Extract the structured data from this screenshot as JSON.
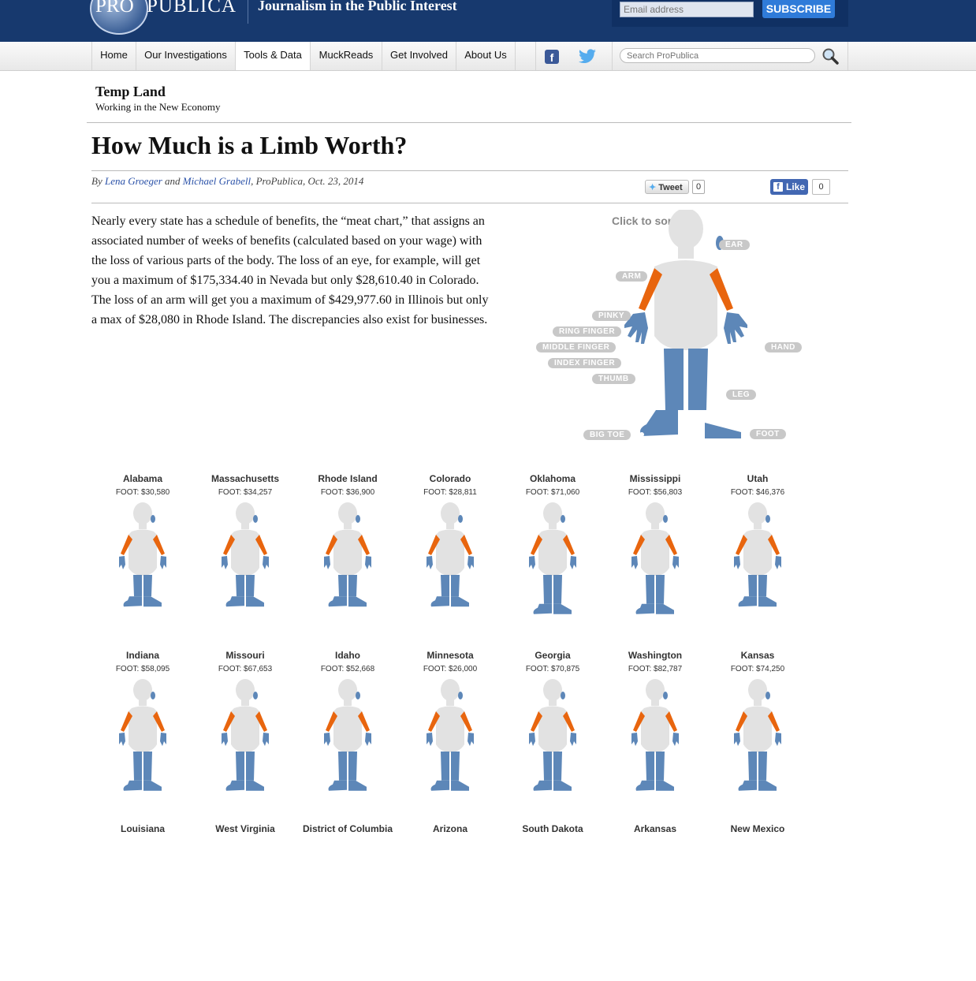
{
  "header": {
    "logo_pro": "PRO",
    "logo_publica": "PUBLICA",
    "tagline": "Journalism in the Public Interest",
    "email_placeholder": "Email address",
    "subscribe_label": "SUBSCRIBE"
  },
  "nav": {
    "items": [
      {
        "label": "Home"
      },
      {
        "label": "Our Investigations"
      },
      {
        "label": "Tools & Data"
      },
      {
        "label": "MuckReads"
      },
      {
        "label": "Get Involved"
      },
      {
        "label": "About Us"
      }
    ],
    "search_placeholder": "Search ProPublica"
  },
  "section": {
    "title": "Temp Land",
    "subtitle": "Working in the New Economy"
  },
  "article": {
    "headline": "How Much is a Limb Worth?",
    "byline_by": "By",
    "author1": "Lena Groeger",
    "byline_and": "and",
    "author2": "Michael Grabell",
    "byline_rest": ", ProPublica, Oct. 23, 2014",
    "tweet_label": "Tweet",
    "tweet_count": "0",
    "like_label": "Like",
    "like_count": "0",
    "intro": "Nearly every state has a schedule of benefits, the “meat chart,” that assigns an associated number of weeks of benefits (calculated based on your wage) with the loss of various parts of the body. The loss of an eye, for example, will get you a maximum of $175,334.40 in Nevada but only $28,610.40 in Colorado. The loss of an arm will get you a maximum of $429,977.60 in Illinois but only a max of $28,080 in Rhode Island. The discrepancies also exist for businesses."
  },
  "sorter": {
    "label": "Click to sort:",
    "parts": [
      "EAR",
      "ARM",
      "PINKY",
      "RING FINGER",
      "MIDDLE FINGER",
      "INDEX FINGER",
      "THUMB",
      "HAND",
      "LEG",
      "BIG TOE",
      "FOOT"
    ]
  },
  "colors": {
    "arm": "#e8650e",
    "leg": "#5d87b8",
    "body": "#e2e2e2",
    "header_bg": "#17396e"
  },
  "states_row1": [
    {
      "name": "Alabama",
      "foot": "FOOT: $30,580"
    },
    {
      "name": "Massachusetts",
      "foot": "FOOT: $34,257"
    },
    {
      "name": "Rhode Island",
      "foot": "FOOT: $36,900"
    },
    {
      "name": "Colorado",
      "foot": "FOOT: $28,811"
    },
    {
      "name": "Oklahoma",
      "foot": "FOOT: $71,060"
    },
    {
      "name": "Mississippi",
      "foot": "FOOT: $56,803"
    },
    {
      "name": "Utah",
      "foot": "FOOT: $46,376"
    }
  ],
  "states_row2": [
    {
      "name": "Indiana",
      "foot": "FOOT: $58,095"
    },
    {
      "name": "Missouri",
      "foot": "FOOT: $67,653"
    },
    {
      "name": "Idaho",
      "foot": "FOOT: $52,668"
    },
    {
      "name": "Minnesota",
      "foot": "FOOT: $26,000"
    },
    {
      "name": "Georgia",
      "foot": "FOOT: $70,875"
    },
    {
      "name": "Washington",
      "foot": "FOOT: $82,787"
    },
    {
      "name": "Kansas",
      "foot": "FOOT: $74,250"
    }
  ],
  "states_row3": [
    {
      "name": "Louisiana"
    },
    {
      "name": "West Virginia"
    },
    {
      "name": "District of Columbia"
    },
    {
      "name": "Arizona"
    },
    {
      "name": "South Dakota"
    },
    {
      "name": "Arkansas"
    },
    {
      "name": "New Mexico"
    }
  ]
}
